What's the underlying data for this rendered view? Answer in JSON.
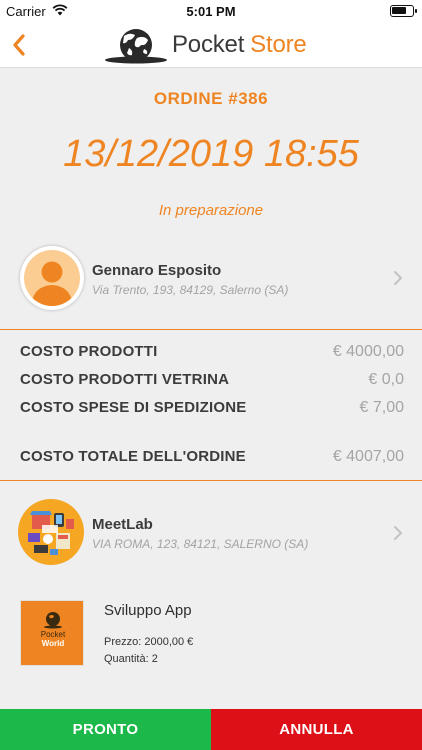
{
  "status_bar": {
    "carrier": "Carrier",
    "time": "5:01 PM"
  },
  "header": {
    "brand_part1": "Pocket",
    "brand_part2": "Store",
    "back_icon": "chevron-left-icon",
    "logo_icon": "globe-icon"
  },
  "order": {
    "number": "ORDINE #386",
    "date": "13/12/2019 18:55",
    "status": "In preparazione"
  },
  "customer": {
    "name": "Gennaro Esposito",
    "address": "Via Trento, 193, 84129, Salerno (SA)"
  },
  "costs": {
    "products_label": "COSTO PRODOTTI",
    "products_value": "€ 4000,00",
    "showcase_label": "COSTO PRODOTTI VETRINA",
    "showcase_value": "€ 0,0",
    "shipping_label": "COSTO SPESE DI SPEDIZIONE",
    "shipping_value": "€ 7,00",
    "total_label": "COSTO TOTALE DELL'ORDINE",
    "total_value": "€ 4007,00"
  },
  "store": {
    "name": "MeetLab",
    "address": "VIA ROMA, 123, 84121, SALERNO (SA)"
  },
  "product": {
    "name": "Sviluppo App",
    "price": "Prezzo: 2000,00 €",
    "quantity": "Quantità: 2",
    "image_line1": "Pocket",
    "image_line2": "World"
  },
  "actions": {
    "ready": "PRONTO",
    "cancel": "ANNULLA"
  },
  "colors": {
    "accent": "#ef8522",
    "ready": "#1db84a",
    "cancel": "#dd0f17"
  }
}
